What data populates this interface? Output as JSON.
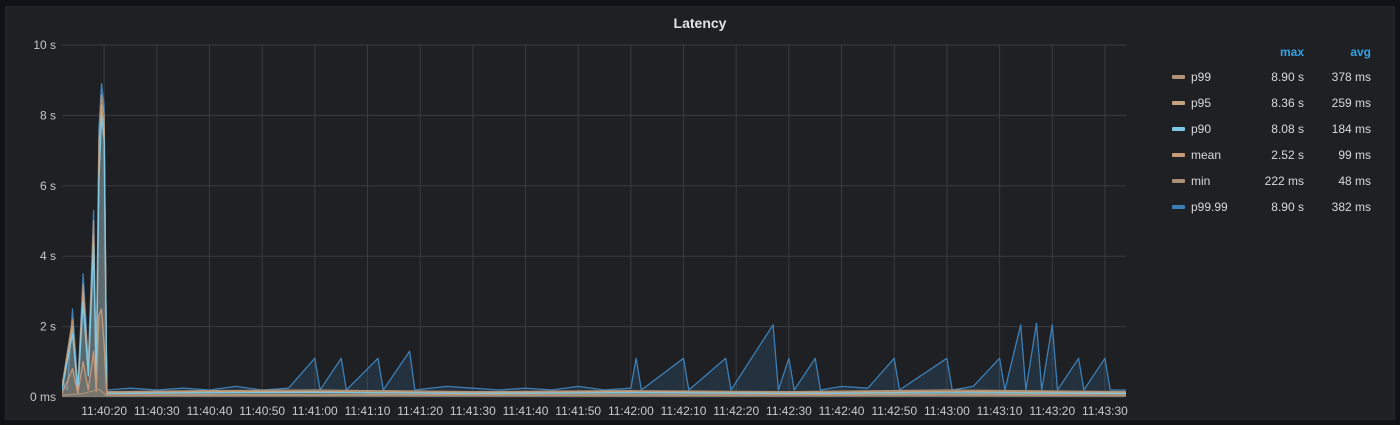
{
  "panel": {
    "title": "Latency"
  },
  "colors": {
    "background": "#1f2024",
    "grid": "#3a3b40",
    "axis_text": "#c7c8ca",
    "legend_header": "#33a2e5"
  },
  "legend": {
    "headers": {
      "max": "max",
      "avg": "avg"
    },
    "rows": [
      {
        "name": "p99",
        "max": "8.90 s",
        "avg": "378 ms",
        "color": "#b29377"
      },
      {
        "name": "p95",
        "max": "8.36 s",
        "avg": "259 ms",
        "color": "#c4a17d"
      },
      {
        "name": "p90",
        "max": "8.08 s",
        "avg": "184 ms",
        "color": "#7ec8e3"
      },
      {
        "name": "mean",
        "max": "2.52 s",
        "avg": "99 ms",
        "color": "#c59a7a"
      },
      {
        "name": "min",
        "max": "222 ms",
        "avg": "48 ms",
        "color": "#a98f75"
      },
      {
        "name": "p99.99",
        "max": "8.90 s",
        "avg": "382 ms",
        "color": "#3d7fb5"
      }
    ]
  },
  "chart_data": {
    "type": "line",
    "title": "Latency",
    "xlabel": "",
    "ylabel": "",
    "x_range": [
      "11:40:12",
      "11:43:34"
    ],
    "ylim": [
      0,
      10
    ],
    "y_unit": "s",
    "y_ticks": [
      {
        "value": 0,
        "label": "0 ms"
      },
      {
        "value": 2,
        "label": "2 s"
      },
      {
        "value": 4,
        "label": "4 s"
      },
      {
        "value": 6,
        "label": "6 s"
      },
      {
        "value": 8,
        "label": "8 s"
      },
      {
        "value": 10,
        "label": "10 s"
      }
    ],
    "x_ticks": [
      "11:40:20",
      "11:40:30",
      "11:40:40",
      "11:40:50",
      "11:41:00",
      "11:41:10",
      "11:41:20",
      "11:41:30",
      "11:41:40",
      "11:41:50",
      "11:42:00",
      "11:42:10",
      "11:42:20",
      "11:42:30",
      "11:42:40",
      "11:42:50",
      "11:43:00",
      "11:43:10",
      "11:43:20",
      "11:43:30"
    ],
    "grid": true,
    "legend_position": "right",
    "series": [
      {
        "name": "p99.99",
        "color": "#3d7fb5",
        "points": [
          [
            "11:40:12",
            0.5
          ],
          [
            "11:40:13",
            0.2
          ],
          [
            "11:40:14",
            2.5
          ],
          [
            "11:40:15",
            0.3
          ],
          [
            "11:40:16",
            3.5
          ],
          [
            "11:40:17",
            1.0
          ],
          [
            "11:40:18",
            5.3
          ],
          [
            "11:40:18.5",
            0.6
          ],
          [
            "11:40:19",
            7.6
          ],
          [
            "11:40:19.5",
            8.9
          ],
          [
            "11:40:20",
            8.3
          ],
          [
            "11:40:20.5",
            0.2
          ],
          [
            "11:40:25",
            0.25
          ],
          [
            "11:40:30",
            0.2
          ],
          [
            "11:40:35",
            0.25
          ],
          [
            "11:40:40",
            0.2
          ],
          [
            "11:40:45",
            0.3
          ],
          [
            "11:40:50",
            0.2
          ],
          [
            "11:40:55",
            0.25
          ],
          [
            "11:41:00",
            1.1
          ],
          [
            "11:41:01",
            0.2
          ],
          [
            "11:41:05",
            1.1
          ],
          [
            "11:41:06",
            0.2
          ],
          [
            "11:41:12",
            1.1
          ],
          [
            "11:41:13",
            0.2
          ],
          [
            "11:41:18",
            1.3
          ],
          [
            "11:41:19",
            0.2
          ],
          [
            "11:41:25",
            0.3
          ],
          [
            "11:41:30",
            0.25
          ],
          [
            "11:41:35",
            0.2
          ],
          [
            "11:41:40",
            0.25
          ],
          [
            "11:41:45",
            0.2
          ],
          [
            "11:41:50",
            0.3
          ],
          [
            "11:41:55",
            0.2
          ],
          [
            "11:42:00",
            0.25
          ],
          [
            "11:42:01",
            1.1
          ],
          [
            "11:42:02",
            0.2
          ],
          [
            "11:42:10",
            1.1
          ],
          [
            "11:42:11",
            0.2
          ],
          [
            "11:42:18",
            1.1
          ],
          [
            "11:42:19",
            0.2
          ],
          [
            "11:42:27",
            2.05
          ],
          [
            "11:42:28",
            0.2
          ],
          [
            "11:42:30",
            1.1
          ],
          [
            "11:42:31",
            0.2
          ],
          [
            "11:42:35",
            1.1
          ],
          [
            "11:42:36",
            0.2
          ],
          [
            "11:42:40",
            0.3
          ],
          [
            "11:42:45",
            0.25
          ],
          [
            "11:42:50",
            1.1
          ],
          [
            "11:42:51",
            0.2
          ],
          [
            "11:43:00",
            1.1
          ],
          [
            "11:43:01",
            0.2
          ],
          [
            "11:43:05",
            0.3
          ],
          [
            "11:43:10",
            1.1
          ],
          [
            "11:43:11",
            0.2
          ],
          [
            "11:43:14",
            2.05
          ],
          [
            "11:43:15",
            0.2
          ],
          [
            "11:43:17",
            2.1
          ],
          [
            "11:43:18",
            0.2
          ],
          [
            "11:43:20",
            2.05
          ],
          [
            "11:43:21",
            0.2
          ],
          [
            "11:43:25",
            1.1
          ],
          [
            "11:43:26",
            0.2
          ],
          [
            "11:43:30",
            1.1
          ],
          [
            "11:43:31",
            0.2
          ],
          [
            "11:43:34",
            0.2
          ]
        ]
      },
      {
        "name": "p99",
        "color": "#b29377",
        "points": [
          [
            "11:40:12",
            0.3
          ],
          [
            "11:40:14",
            2.2
          ],
          [
            "11:40:15",
            0.2
          ],
          [
            "11:40:16",
            3.2
          ],
          [
            "11:40:17",
            0.8
          ],
          [
            "11:40:18",
            5.0
          ],
          [
            "11:40:18.5",
            0.4
          ],
          [
            "11:40:19",
            7.3
          ],
          [
            "11:40:19.5",
            8.6
          ],
          [
            "11:40:20",
            8.0
          ],
          [
            "11:40:20.5",
            0.15
          ],
          [
            "11:40:40",
            0.18
          ],
          [
            "11:41:00",
            0.2
          ],
          [
            "11:41:30",
            0.15
          ],
          [
            "11:42:00",
            0.18
          ],
          [
            "11:42:30",
            0.15
          ],
          [
            "11:43:00",
            0.2
          ],
          [
            "11:43:34",
            0.15
          ]
        ]
      },
      {
        "name": "p95",
        "color": "#c4a17d",
        "points": [
          [
            "11:40:12",
            0.25
          ],
          [
            "11:40:14",
            2.0
          ],
          [
            "11:40:15",
            0.2
          ],
          [
            "11:40:16",
            3.0
          ],
          [
            "11:40:17",
            0.7
          ],
          [
            "11:40:18",
            4.6
          ],
          [
            "11:40:18.5",
            0.35
          ],
          [
            "11:40:19",
            6.5
          ],
          [
            "11:40:19.5",
            8.3
          ],
          [
            "11:40:20",
            7.6
          ],
          [
            "11:40:20.5",
            0.12
          ],
          [
            "11:40:40",
            0.15
          ],
          [
            "11:41:00",
            0.16
          ],
          [
            "11:41:30",
            0.12
          ],
          [
            "11:42:00",
            0.15
          ],
          [
            "11:42:30",
            0.12
          ],
          [
            "11:43:00",
            0.16
          ],
          [
            "11:43:34",
            0.12
          ]
        ]
      },
      {
        "name": "p90",
        "color": "#7ec8e3",
        "points": [
          [
            "11:40:12",
            0.2
          ],
          [
            "11:40:14",
            1.8
          ],
          [
            "11:40:15",
            0.15
          ],
          [
            "11:40:16",
            2.7
          ],
          [
            "11:40:17",
            0.6
          ],
          [
            "11:40:18",
            4.3
          ],
          [
            "11:40:18.5",
            0.3
          ],
          [
            "11:40:19",
            6.1
          ],
          [
            "11:40:19.5",
            8.0
          ],
          [
            "11:40:20",
            7.3
          ],
          [
            "11:40:20.5",
            0.1
          ],
          [
            "11:40:40",
            0.12
          ],
          [
            "11:41:00",
            0.13
          ],
          [
            "11:41:30",
            0.1
          ],
          [
            "11:42:00",
            0.12
          ],
          [
            "11:42:30",
            0.1
          ],
          [
            "11:43:00",
            0.12
          ],
          [
            "11:43:34",
            0.1
          ]
        ]
      },
      {
        "name": "mean",
        "color": "#c59a7a",
        "points": [
          [
            "11:40:12",
            0.1
          ],
          [
            "11:40:14",
            0.8
          ],
          [
            "11:40:15",
            0.1
          ],
          [
            "11:40:16",
            1.0
          ],
          [
            "11:40:17",
            0.2
          ],
          [
            "11:40:18",
            1.3
          ],
          [
            "11:40:18.5",
            0.15
          ],
          [
            "11:40:19",
            2.3
          ],
          [
            "11:40:19.5",
            2.5
          ],
          [
            "11:40:20",
            1.5
          ],
          [
            "11:40:20.5",
            0.06
          ],
          [
            "11:41:00",
            0.07
          ],
          [
            "11:42:00",
            0.06
          ],
          [
            "11:43:00",
            0.07
          ],
          [
            "11:43:34",
            0.06
          ]
        ]
      },
      {
        "name": "min",
        "color": "#a98f75",
        "points": [
          [
            "11:40:12",
            0.05
          ],
          [
            "11:40:16",
            0.1
          ],
          [
            "11:40:19",
            0.22
          ],
          [
            "11:40:20.5",
            0.04
          ],
          [
            "11:41:00",
            0.05
          ],
          [
            "11:42:00",
            0.04
          ],
          [
            "11:43:00",
            0.05
          ],
          [
            "11:43:34",
            0.04
          ]
        ]
      }
    ]
  }
}
